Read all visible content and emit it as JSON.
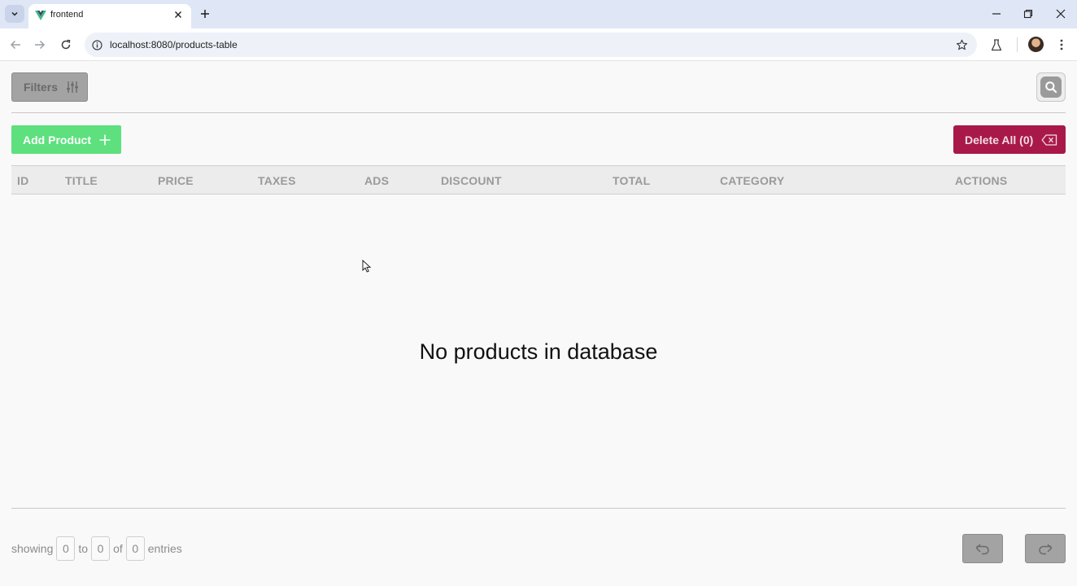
{
  "browser": {
    "tab_title": "frontend",
    "url": "localhost:8080/products-table"
  },
  "toolbar": {
    "filters_label": "Filters",
    "add_label": "Add Product",
    "delete_label": "Delete All (0)"
  },
  "table": {
    "columns": [
      "ID",
      "TITLE",
      "PRICE",
      "TAXES",
      "ADS",
      "DISCOUNT",
      "TOTAL",
      "CATEGORY",
      "ACTIONS"
    ],
    "empty_message": "No products in database"
  },
  "footer": {
    "showing": "showing",
    "from": "0",
    "to_word": "to",
    "to": "0",
    "of_word": "of",
    "total": "0",
    "entries": "entries"
  },
  "colors": {
    "add_button": "#5de07d",
    "delete_button": "#a8194a",
    "filters_button": "#a3a3a3",
    "vue_logo": "#41b883"
  }
}
